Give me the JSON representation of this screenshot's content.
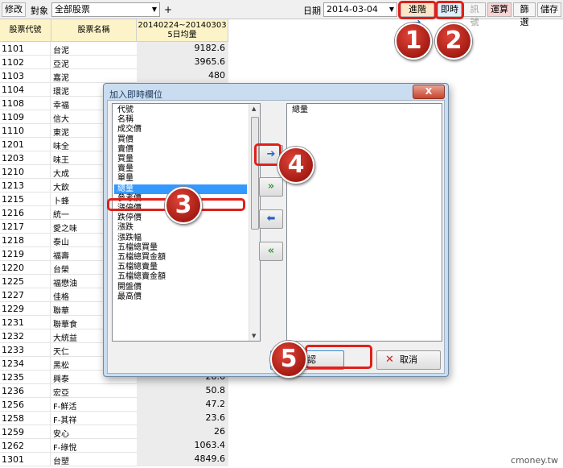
{
  "toolbar": {
    "edit_label": "修改",
    "object_label": "對象",
    "object_value": "全部股票",
    "plus_label": "+",
    "date_label": "日期",
    "date_value": "2014-03-04",
    "advanced_label": "進階",
    "realtime_label": "即時",
    "history_label": "訊號",
    "calc_label": "運算",
    "filter_label": "篩選",
    "save_label": "儲存"
  },
  "grid": {
    "headers": [
      "股票代號",
      "股票名稱",
      "20140224~20140303",
      "5日均量"
    ],
    "rows": [
      {
        "code": "1101",
        "name": "台泥",
        "value": "9182.6"
      },
      {
        "code": "1102",
        "name": "亞泥",
        "value": "3965.6"
      },
      {
        "code": "1103",
        "name": "嘉泥",
        "value": "480"
      },
      {
        "code": "1104",
        "name": "環泥",
        "value": ""
      },
      {
        "code": "1108",
        "name": "幸福",
        "value": ""
      },
      {
        "code": "1109",
        "name": "信大",
        "value": ""
      },
      {
        "code": "1110",
        "name": "東泥",
        "value": ""
      },
      {
        "code": "1201",
        "name": "味全",
        "value": ""
      },
      {
        "code": "1203",
        "name": "味王",
        "value": ""
      },
      {
        "code": "1210",
        "name": "大成",
        "value": ""
      },
      {
        "code": "1213",
        "name": "大飲",
        "value": ""
      },
      {
        "code": "1215",
        "name": "卜蜂",
        "value": ""
      },
      {
        "code": "1216",
        "name": "統一",
        "value": ""
      },
      {
        "code": "1217",
        "name": "愛之味",
        "value": ""
      },
      {
        "code": "1218",
        "name": "泰山",
        "value": ""
      },
      {
        "code": "1219",
        "name": "福壽",
        "value": ""
      },
      {
        "code": "1220",
        "name": "台榮",
        "value": ""
      },
      {
        "code": "1225",
        "name": "福懋油",
        "value": ""
      },
      {
        "code": "1227",
        "name": "佳格",
        "value": ""
      },
      {
        "code": "1229",
        "name": "聯華",
        "value": ""
      },
      {
        "code": "1231",
        "name": "聯華食",
        "value": ""
      },
      {
        "code": "1232",
        "name": "大統益",
        "value": ""
      },
      {
        "code": "1233",
        "name": "天仁",
        "value": ""
      },
      {
        "code": "1234",
        "name": "黑松",
        "value": ""
      },
      {
        "code": "1235",
        "name": "興泰",
        "value": "28.6"
      },
      {
        "code": "1236",
        "name": "宏亞",
        "value": "50.8"
      },
      {
        "code": "1256",
        "name": "F-鮮活",
        "value": "47.2"
      },
      {
        "code": "1258",
        "name": "F-其祥",
        "value": "23.6"
      },
      {
        "code": "1259",
        "name": "安心",
        "value": "26"
      },
      {
        "code": "1262",
        "name": "F-綠悅",
        "value": "1063.4"
      },
      {
        "code": "1301",
        "name": "台塑",
        "value": "4849.6"
      }
    ]
  },
  "dialog": {
    "title": "加入即時欄位",
    "close_label": "X",
    "available_fields": [
      "代號",
      "名稱",
      "成交價",
      "買價",
      "賣價",
      "買量",
      "賣量",
      "單量",
      "總量",
      "參考價",
      "漲停價",
      "跌停價",
      "漲跌",
      "漲跌幅",
      "五檔總買量",
      "五檔總買金額",
      "五檔總賣量",
      "五檔總賣金額",
      "開盤價",
      "最高價"
    ],
    "selected_index": 8,
    "chosen_fields": [
      "總量"
    ],
    "ok_label": "確認",
    "cancel_label": "取消"
  },
  "steps": [
    "1",
    "2",
    "3",
    "4",
    "5"
  ],
  "watermark": "cmoney.tw",
  "colors": {
    "accent_red": "#e0201a",
    "selection": "#3399ff",
    "header_bg": "#fcf4c8"
  }
}
